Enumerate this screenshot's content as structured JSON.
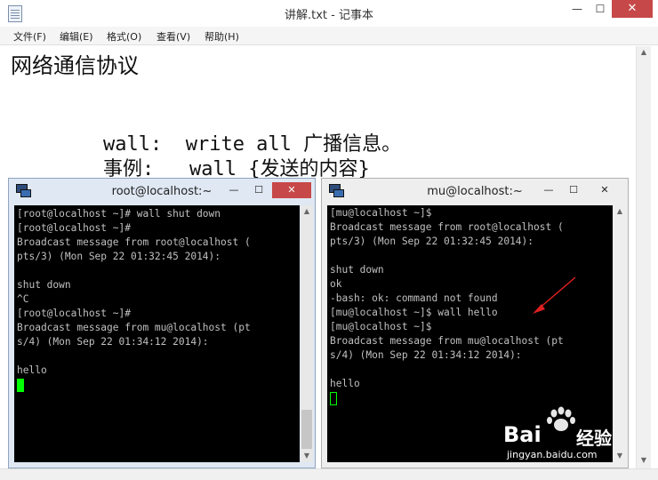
{
  "notepad": {
    "title": "讲解.txt - 记事本",
    "controls": {
      "minimize": "—",
      "maximize": "☐",
      "close": "✕"
    },
    "menu": [
      "文件(F)",
      "编辑(E)",
      "格式(O)",
      "查看(V)",
      "帮助(H)"
    ],
    "content": {
      "heading": "网络通信协议",
      "line1": "wall:  write all 广播信息。",
      "line2": "事例:   wall {发送的内容}"
    }
  },
  "putty_left": {
    "title": "root@localhost:~",
    "lines": [
      "[root@localhost ~]# wall shut down",
      "[root@localhost ~]#",
      "Broadcast message from root@localhost (",
      "pts/3) (Mon Sep 22 01:32:45 2014):",
      "",
      "shut down",
      "^C",
      "[root@localhost ~]#",
      "Broadcast message from mu@localhost (pt",
      "s/4) (Mon Sep 22 01:34:12 2014):",
      "",
      "hello"
    ]
  },
  "putty_right": {
    "title": "mu@localhost:~",
    "lines": [
      "[mu@localhost ~]$",
      "Broadcast message from root@localhost (",
      "pts/3) (Mon Sep 22 01:32:45 2014):",
      "",
      "shut down",
      "ok",
      "-bash: ok: command not found",
      "[mu@localhost ~]$ wall hello",
      "[mu@localhost ~]$",
      "Broadcast message from mu@localhost (pt",
      "s/4) (Mon Sep 22 01:34:12 2014):",
      "",
      "hello"
    ]
  },
  "watermark": {
    "brand": "Bai",
    "brand2": "经验",
    "site": "jingyan.baidu.com"
  },
  "colors": {
    "cursor": "#00ff00",
    "arrow": "#e02020",
    "close": "#c74848"
  }
}
